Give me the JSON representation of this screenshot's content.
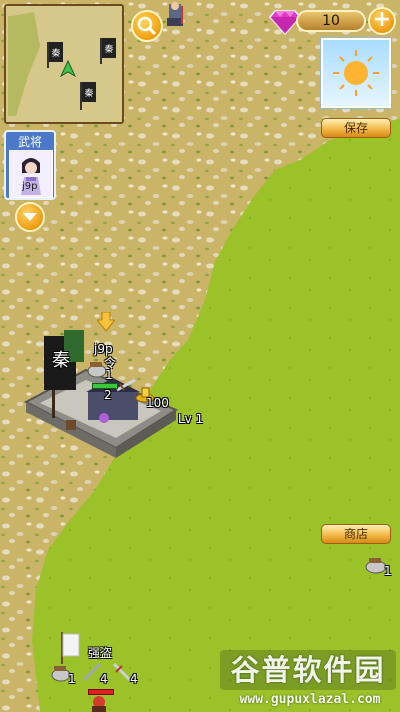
{
  "hud": {
    "gems": "10",
    "gem_icon": "diamond-icon",
    "add_icon": "plus-icon",
    "search_icon": "magnifier-icon",
    "save_label": "保存",
    "shop_label": "商店"
  },
  "minimap": {
    "flags": [
      "秦",
      "秦",
      "秦"
    ]
  },
  "general_panel": {
    "title": "武将",
    "card_name": "j9p"
  },
  "base": {
    "flag_text": "秦",
    "owner": "j9p",
    "command_label": "令",
    "command_count": "1",
    "troop_count": "2",
    "gold_count": "100",
    "level": "Lv 1"
  },
  "right_unit": {
    "count": "1"
  },
  "bandits": {
    "name": "强盗",
    "counts": [
      "1",
      "4",
      "4"
    ]
  },
  "watermark": {
    "title": "谷普软件园",
    "url": "www.gupuxlazal.com"
  },
  "colors": {
    "sand": "#c9b468",
    "grass": "#9cc22a",
    "gold": "#f0a010",
    "panel_blue": "#4c78c8"
  }
}
